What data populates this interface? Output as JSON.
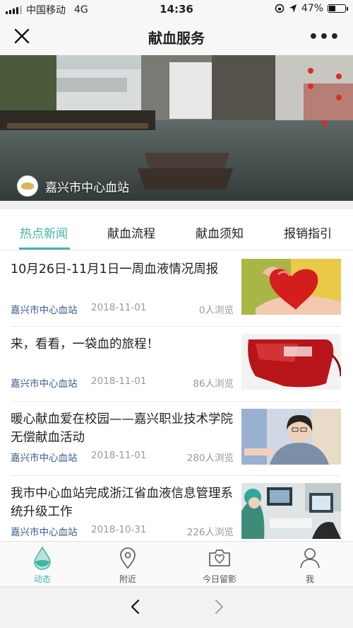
{
  "status_bar": {
    "carrier": "中国移动",
    "network": "4G",
    "time": "14:36",
    "battery_percent": "47%",
    "battery_level": 0.47
  },
  "nav": {
    "title": "献血服务"
  },
  "banner": {
    "station_name": "嘉兴市中心血站"
  },
  "tabs": [
    {
      "label": "热点新闻",
      "active": true
    },
    {
      "label": "献血流程",
      "active": false
    },
    {
      "label": "献血须知",
      "active": false
    },
    {
      "label": "报销指引",
      "active": false
    }
  ],
  "news": [
    {
      "title": "10月26日-11月1日一周血液情况周报",
      "source": "嘉兴市中心血站",
      "date": "2018-11-01",
      "views": "0人浏览",
      "thumb": "heart-in-hands"
    },
    {
      "title": "来，看看，一袋血的旅程！",
      "source": "嘉兴市中心血站",
      "date": "2018-11-01",
      "views": "86人浏览",
      "thumb": "blood-bag"
    },
    {
      "title": "暖心献血爱在校园——嘉兴职业技术学院无偿献血活动",
      "source": "嘉兴市中心血站",
      "date": "2018-11-01",
      "views": "280人浏览",
      "thumb": "student-donor"
    },
    {
      "title": "我市中心血站完成浙江省血液信息管理系统升级工作",
      "source": "嘉兴市中心血站",
      "date": "2018-10-31",
      "views": "226人浏览",
      "thumb": "lab-workers"
    }
  ],
  "tabbar": [
    {
      "label": "动态",
      "icon": "drop-icon",
      "active": true
    },
    {
      "label": "附近",
      "icon": "location-pin-icon",
      "active": false
    },
    {
      "label": "今日留影",
      "icon": "camera-heart-icon",
      "active": false
    },
    {
      "label": "我",
      "icon": "person-icon",
      "active": false
    }
  ],
  "colors": {
    "accent": "#3fb5a6",
    "source_link": "#3a5c8a",
    "meta_gray": "#999999"
  }
}
